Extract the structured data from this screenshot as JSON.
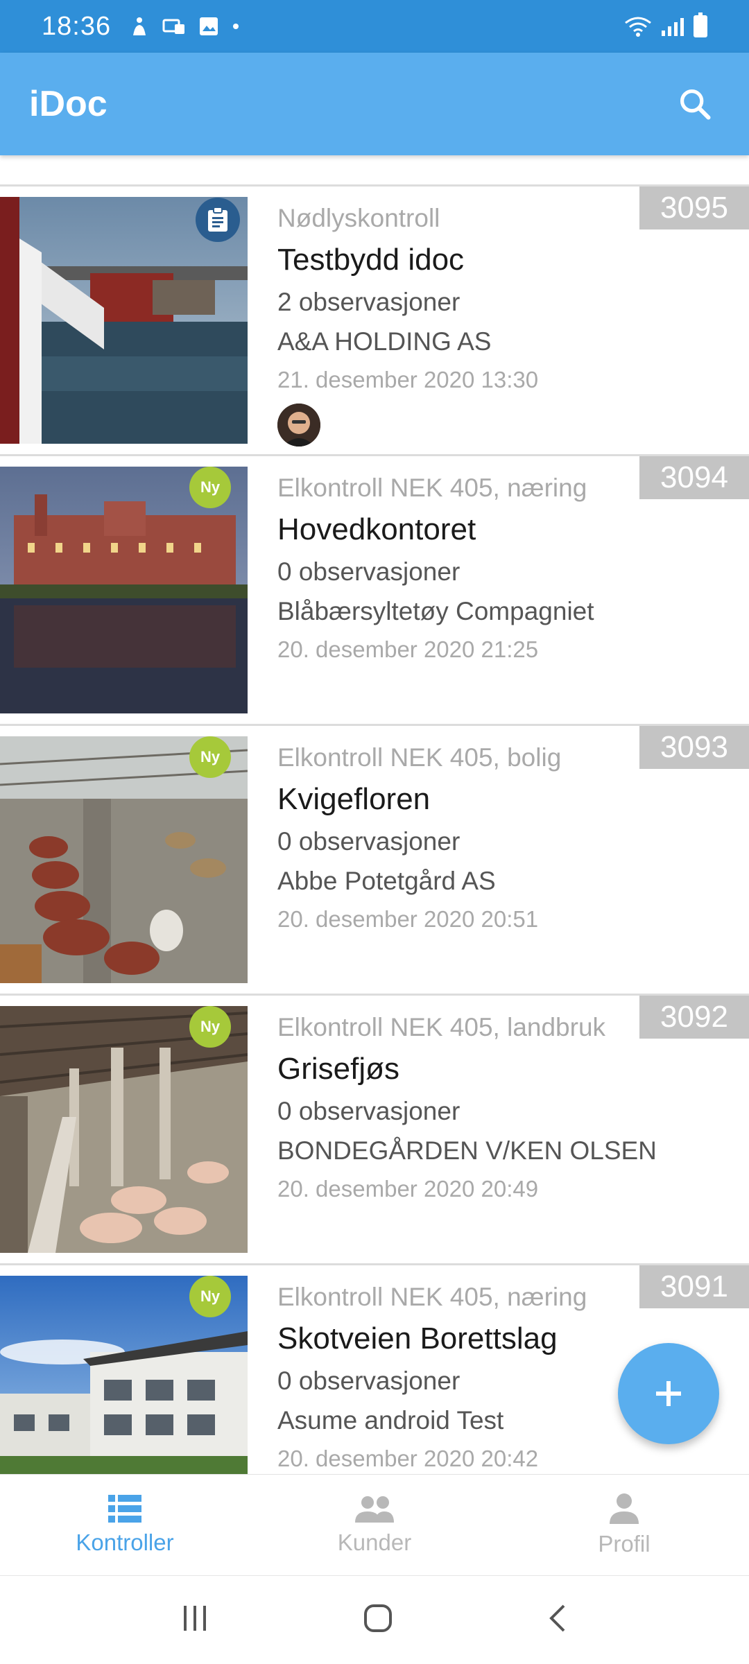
{
  "status_bar": {
    "time": "18:36"
  },
  "app_bar": {
    "title": "iDoc"
  },
  "colors": {
    "accent": "#5aaeee",
    "status": "#2f8fd8",
    "badge_new": "#a6c93a",
    "number_bg": "#c4c4c4"
  },
  "items": [
    {
      "number": "3095",
      "category": "Nødlyskontroll",
      "title": "Testbydd idoc",
      "observations": "2 observasjoner",
      "customer": "A&A HOLDING AS",
      "date": "21. desember 2020 13:30",
      "badge": "document-icon"
    },
    {
      "number": "3094",
      "category": "Elkontroll NEK 405, næring",
      "title": "Hovedkontoret",
      "observations": "0 observasjoner",
      "customer": "Blåbærsyltetøy Compagniet",
      "date": "20. desember 2020 21:25",
      "badge": "Ny"
    },
    {
      "number": "3093",
      "category": "Elkontroll NEK 405, bolig",
      "title": "Kvigefloren",
      "observations": "0 observasjoner",
      "customer": "Abbe Potetgård AS",
      "date": "20. desember 2020 20:51",
      "badge": "Ny"
    },
    {
      "number": "3092",
      "category": "Elkontroll NEK 405, landbruk",
      "title": "Grisefjøs",
      "observations": "0 observasjoner",
      "customer": "BONDEGÅRDEN V/KEN OLSEN",
      "date": "20. desember 2020 20:49",
      "badge": "Ny"
    },
    {
      "number": "3091",
      "category": "Elkontroll NEK 405, næring",
      "title": "Skotveien Borettslag",
      "observations": "0 observasjoner",
      "customer": "Asume android Test",
      "date": "20. desember 2020 20:42",
      "badge": "Ny"
    }
  ],
  "bottom_nav": {
    "items": [
      {
        "label": "Kontroller",
        "icon": "list-icon",
        "active": true
      },
      {
        "label": "Kunder",
        "icon": "people-icon",
        "active": false
      },
      {
        "label": "Profil",
        "icon": "person-icon",
        "active": false
      }
    ]
  }
}
